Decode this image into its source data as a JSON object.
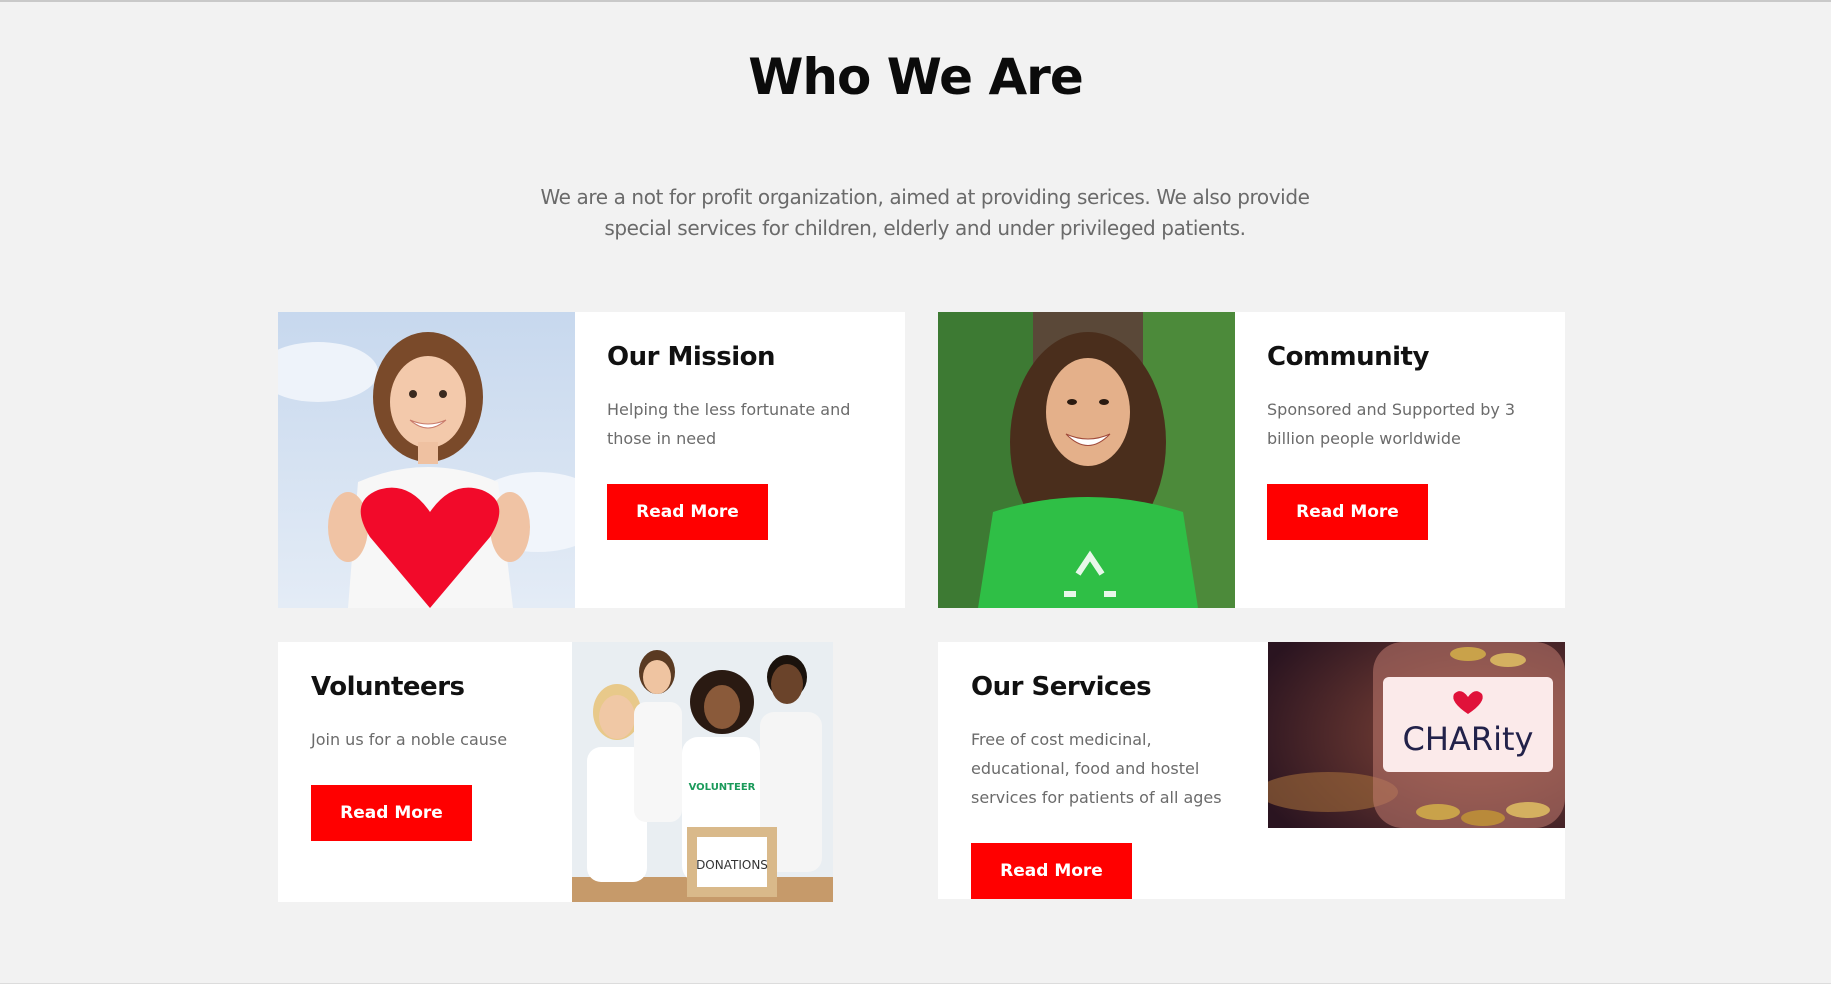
{
  "heading": "Who We Are",
  "intro": "We are a not for profit organization, aimed at providing serices. We also provide special services for children, elderly and under privileged patients.",
  "cards": [
    {
      "title": "Our Mission",
      "text": "Helping the less fortunate and those in need",
      "button": "Read More",
      "image": "girl-holding-heart-photo"
    },
    {
      "title": "Community",
      "text": "Sponsored and Supported by 3 billion people worldwide",
      "button": "Read More",
      "image": "smiling-woman-recycle-shirt-photo"
    },
    {
      "title": "Volunteers",
      "text": "Join us for a noble cause",
      "button": "Read More",
      "image": "volunteers-group-photo",
      "image_text": "DONATIONS"
    },
    {
      "title": "Our Services",
      "text": "Free of cost medicinal, educational, food and hostel services for patients of all ages",
      "button": "Read More",
      "image": "charity-jar-photo",
      "image_text": "CHARity"
    }
  ],
  "colors": {
    "background": "#f2f2f2",
    "card": "#ffffff",
    "accent": "#ff0000",
    "heading": "#0b0b0b",
    "body_text": "#6b6b6b"
  }
}
